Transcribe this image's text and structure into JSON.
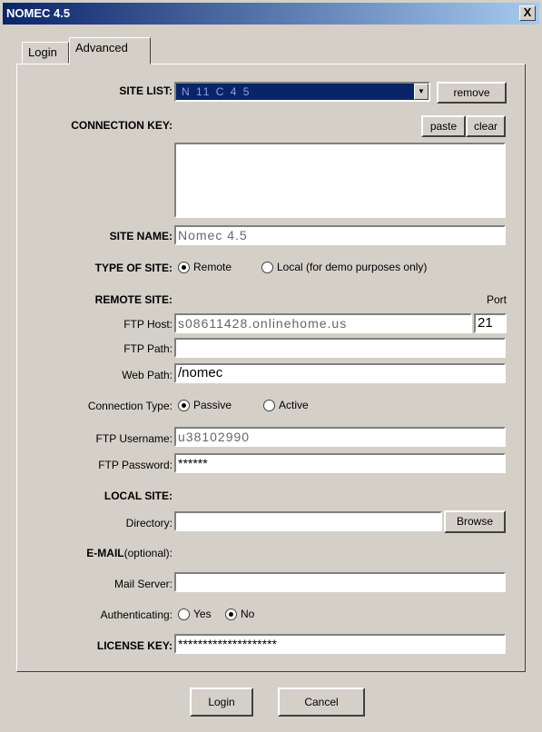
{
  "window": {
    "title": "NOMEC 4.5",
    "close_glyph": "X"
  },
  "tabs": [
    {
      "label": "Login"
    },
    {
      "label": "Advanced"
    }
  ],
  "site_list": {
    "label": "SITE LIST:",
    "value": "N 11 C 4 5",
    "remove_label": "remove"
  },
  "connection_key": {
    "label": "CONNECTION KEY:",
    "paste_label": "paste",
    "clear_label": "clear",
    "value": ""
  },
  "site_name": {
    "label": "SITE NAME:",
    "value": "Nomec 4.5"
  },
  "type_of_site": {
    "label": "TYPE OF SITE:",
    "option_remote": "Remote",
    "option_local": "Local (for demo purposes only)",
    "selected": "Remote"
  },
  "remote_site": {
    "label": "REMOTE SITE:",
    "port_label": "Port",
    "ftp_host_label": "FTP Host:",
    "ftp_host_value": "s08611428.onlinehome.us",
    "port_value": "21",
    "ftp_path_label": "FTP Path:",
    "ftp_path_value": "",
    "web_path_label": "Web Path:",
    "web_path_value": "/nomec"
  },
  "connection_type": {
    "label": "Connection Type:",
    "option_passive": "Passive",
    "option_active": "Active",
    "selected": "Passive"
  },
  "ftp_username": {
    "label": "FTP Username:",
    "value": "u38102990"
  },
  "ftp_password": {
    "label": "FTP Password:",
    "value": "******"
  },
  "local_site": {
    "label": "LOCAL SITE:",
    "directory_label": "Directory:",
    "directory_value": "",
    "browse_label": "Browse"
  },
  "email": {
    "label": "E-MAIL",
    "label_optional": "(optional):",
    "mail_server_label": "Mail Server:",
    "mail_server_value": "",
    "auth_label": "Authenticating:",
    "option_yes": "Yes",
    "option_no": "No",
    "selected": "No"
  },
  "license_key": {
    "label": "LICENSE KEY:",
    "value": "********************"
  },
  "footer": {
    "login_label": "Login",
    "cancel_label": "Cancel"
  }
}
